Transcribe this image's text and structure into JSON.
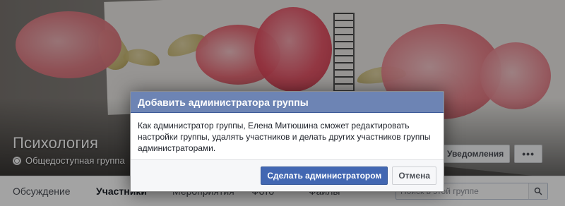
{
  "group": {
    "title": "Психология",
    "privacy": "Общедоступная группа"
  },
  "cover_actions": {
    "notifications_label": "Уведомления",
    "more_label": "•••"
  },
  "tabs": [
    {
      "label": "Обсуждение"
    },
    {
      "label": "Участники"
    },
    {
      "label": "Мероприятия"
    },
    {
      "label": "Фото"
    },
    {
      "label": "Файлы"
    }
  ],
  "search": {
    "placeholder": "Поиск в этой группе",
    "value": ""
  },
  "dialog": {
    "title": "Добавить администратора группы",
    "body": "Как администратор группы, Елена Митюшина сможет редактировать настройки группы, удалять участников и делать других участников группы администраторами.",
    "confirm_label": "Сделать администратором",
    "cancel_label": "Отмена"
  },
  "colors": {
    "dialog_header": "#6d84b4",
    "primary_button": "#4267b2",
    "tab_background": "#ffffff",
    "overlay": "rgba(0,0,0,0.36)"
  },
  "icons": {
    "privacy": "globe-icon",
    "notifications": "check-icon",
    "search": "search-icon",
    "more": "more-dots-icon"
  }
}
